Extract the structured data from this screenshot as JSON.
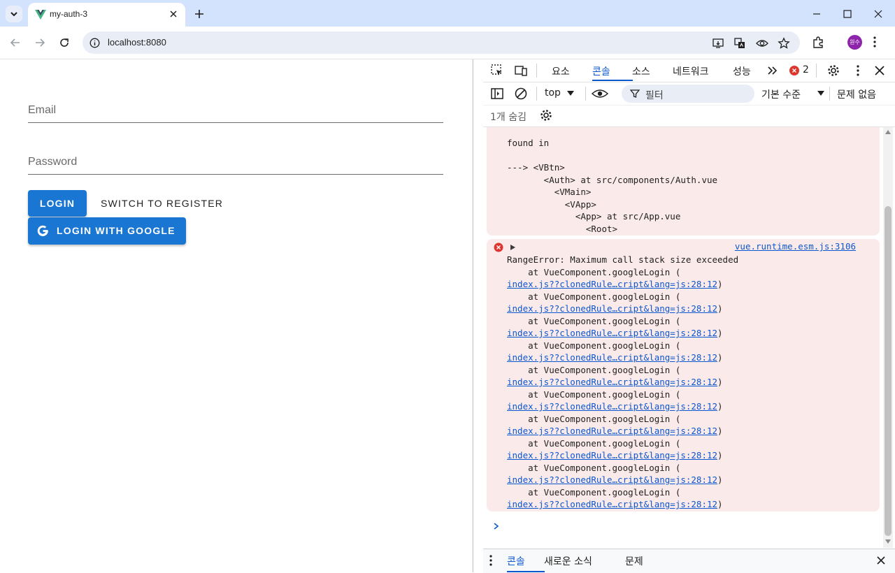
{
  "browser": {
    "tab": {
      "title": "my-auth-3"
    },
    "address_bar": {
      "url": "localhost:8080"
    },
    "profile_avatar": "원수"
  },
  "page": {
    "email_field": {
      "label": "Email"
    },
    "password_field": {
      "label": "Password"
    },
    "login_button": "LOGIN",
    "switch_button": "SWITCH TO REGISTER",
    "google_button": "LOGIN WITH GOOGLE"
  },
  "devtools": {
    "tabs": [
      "요소",
      "콘솔",
      "소스",
      "네트워크",
      "성능"
    ],
    "active_tab": "콘솔",
    "error_count": "2",
    "console_toolbar": {
      "context": "top",
      "filter_placeholder": "필터",
      "levels": "기본 수준",
      "issues": "문제 없음"
    },
    "hidden_count": "1개 숨김",
    "messages": [
      {
        "text": "found in\n\n---> <VBtn>\n       <Auth> at src/components/Auth.vue\n         <VMain>\n           <VApp>\n             <App> at src/App.vue\n               <Root>"
      },
      {
        "source": "vue.runtime.esm.js:3106",
        "error": "RangeError: Maximum call stack size exceeded",
        "frame_text": "    at VueComponent.googleLogin (",
        "frame_link": "index.js??clonedRule…cript&lang=js:28:12",
        "frame_close": ")",
        "frame_count": 10
      }
    ],
    "drawer_tabs": [
      "콘솔",
      "새로운 소식",
      "문제"
    ],
    "active_drawer_tab": "콘솔"
  },
  "colors": {
    "primary_button": "#1976d2",
    "error_background": "#fbeaea",
    "link": "#0b57d0",
    "error_icon": "#dc362e"
  }
}
